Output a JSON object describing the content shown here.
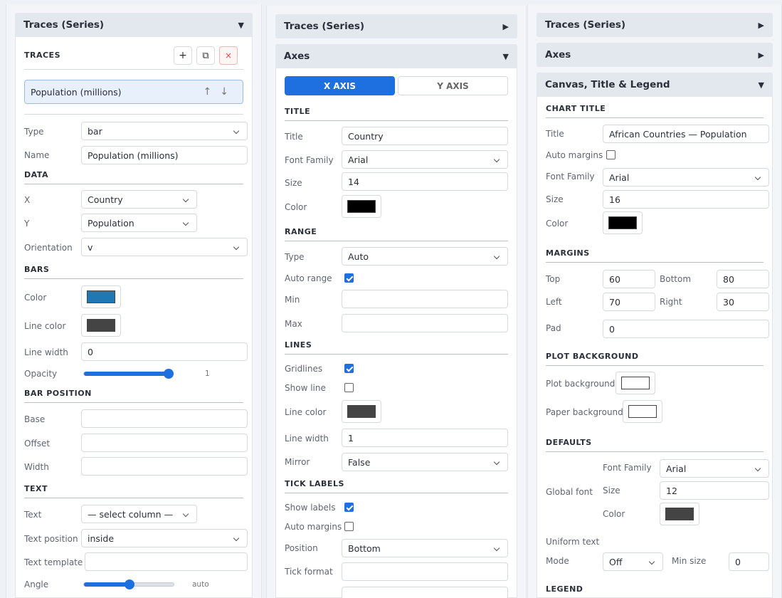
{
  "col1": {
    "header": "Traces (Series)",
    "header_arrow": "▼",
    "traces_label": "TRACES",
    "add_btn": "+",
    "dup_btn": "⧉",
    "del_btn": "×",
    "trace_item": "Population (millions)",
    "trace_arrows": "↑↓",
    "type_label": "Type",
    "type_value": "bar",
    "name_label": "Name",
    "name_value": "Population (millions)",
    "data_section": "DATA",
    "x_label": "X",
    "x_value": "Country",
    "y_label": "Y",
    "y_value": "Population",
    "orientation_label": "Orientation",
    "orientation_value": "v",
    "bars_section": "BARS",
    "color_label": "Color",
    "color_value": "#1f77b4",
    "line_color_label": "Line color",
    "line_color_value": "#444444",
    "line_width_label": "Line width",
    "line_width_value": "0",
    "opacity_label": "Opacity",
    "opacity_value": "1",
    "opacity_fraction": 1.0,
    "bar_position_section": "BAR POSITION",
    "base_label": "Base",
    "offset_label": "Offset",
    "width_label": "Width",
    "text_section": "TEXT",
    "text_label": "Text",
    "text_value": "— select column —",
    "text_position_label": "Text position",
    "text_position_value": "inside",
    "text_template_label": "Text template",
    "angle_label": "Angle",
    "angle_value": "auto",
    "angle_fraction": 0.5
  },
  "col2": {
    "traces_header": "Traces (Series)",
    "traces_arrow": "▶",
    "axes_header": "Axes",
    "axes_arrow": "▼",
    "tab_x": "X AXIS",
    "tab_y": "Y AXIS",
    "title_section": "TITLE",
    "title_label": "Title",
    "title_value": "Country",
    "font_family_label": "Font Family",
    "font_family_value": "Arial",
    "size_label": "Size",
    "size_value": "14",
    "color_label": "Color",
    "color_value": "#000000",
    "range_section": "RANGE",
    "type_label": "Type",
    "type_value": "Auto",
    "auto_range_label": "Auto range",
    "min_label": "Min",
    "max_label": "Max",
    "lines_section": "LINES",
    "gridlines_label": "Gridlines",
    "show_line_label": "Show line",
    "line_color_label": "Line color",
    "line_color_value": "#444444",
    "line_width_label": "Line width",
    "line_width_value": "1",
    "mirror_label": "Mirror",
    "mirror_value": "False",
    "tick_labels_section": "TICK LABELS",
    "show_labels_label": "Show labels",
    "auto_margins_label": "Auto margins",
    "position_label": "Position",
    "position_value": "Bottom",
    "tick_format_label": "Tick format"
  },
  "col3": {
    "traces_header": "Traces (Series)",
    "traces_arrow": "▶",
    "axes_header": "Axes",
    "axes_arrow": "▶",
    "canvas_header": "Canvas, Title & Legend",
    "canvas_arrow": "▼",
    "chart_title_section": "CHART TITLE",
    "title_label": "Title",
    "title_value": "African Countries — Population",
    "auto_margins_label": "Auto margins",
    "font_family_label": "Font Family",
    "font_family_value": "Arial",
    "size_label": "Size",
    "size_value": "16",
    "color_label": "Color",
    "color_value": "#000000",
    "margins_section": "MARGINS",
    "top_label": "Top",
    "top_value": "60",
    "bottom_label": "Bottom",
    "bottom_value": "80",
    "left_label": "Left",
    "left_value": "70",
    "right_label": "Right",
    "right_value": "30",
    "pad_label": "Pad",
    "pad_value": "0",
    "plot_bg_section": "PLOT BACKGROUND",
    "plot_bg_label": "Plot background",
    "plot_bg_value": "#ffffff",
    "paper_bg_label": "Paper background",
    "paper_bg_value": "#ffffff",
    "defaults_section": "DEFAULTS",
    "global_font_label": "Global font",
    "gf_family_label": "Font Family",
    "gf_family_value": "Arial",
    "gf_size_label": "Size",
    "gf_size_value": "12",
    "gf_color_label": "Color",
    "gf_color_value": "#444444",
    "uniform_text_label": "Uniform text",
    "mode_label": "Mode",
    "mode_value": "Off",
    "min_size_label": "Min size",
    "min_size_value": "0",
    "legend_section": "LEGEND"
  }
}
